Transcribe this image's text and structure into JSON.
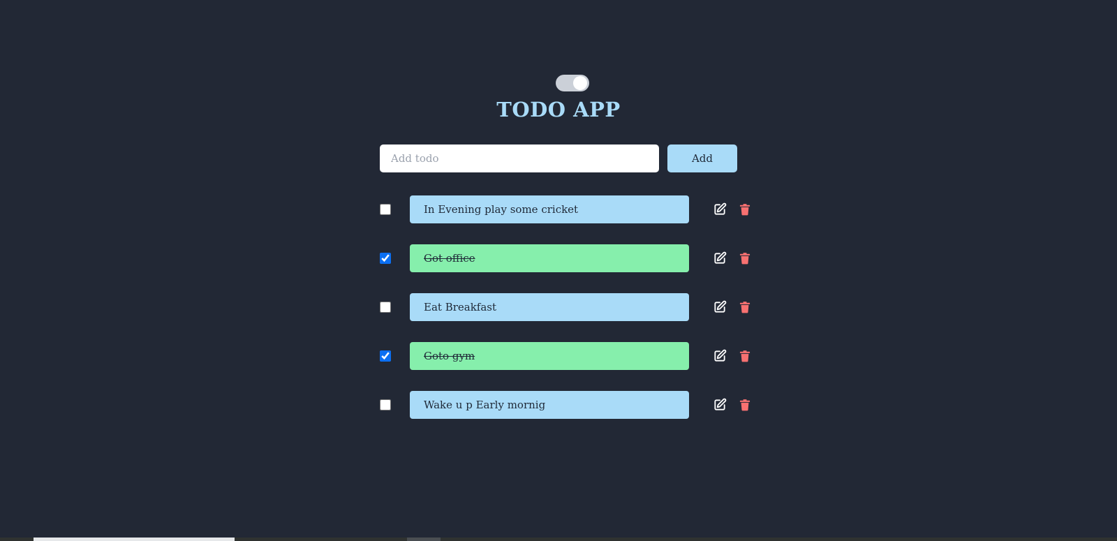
{
  "header": {
    "title": "TODO APP",
    "theme_toggle_on": true
  },
  "add_form": {
    "placeholder": "Add todo",
    "value": "",
    "add_label": "Add"
  },
  "todos": [
    {
      "text": "In Evening play some cricket",
      "completed": false
    },
    {
      "text": "Got office ",
      "completed": true
    },
    {
      "text": "Eat Breakfast",
      "completed": false
    },
    {
      "text": "Goto gym ",
      "completed": true
    },
    {
      "text": "Wake u p Early mornig",
      "completed": false
    }
  ],
  "icons": {
    "edit": "edit-icon",
    "delete": "trash-icon"
  },
  "colors": {
    "background": "#222835",
    "accent": "#a9dbf8",
    "completed": "#86efac",
    "delete": "#f87171",
    "checkbox": "#0b6ff2"
  }
}
